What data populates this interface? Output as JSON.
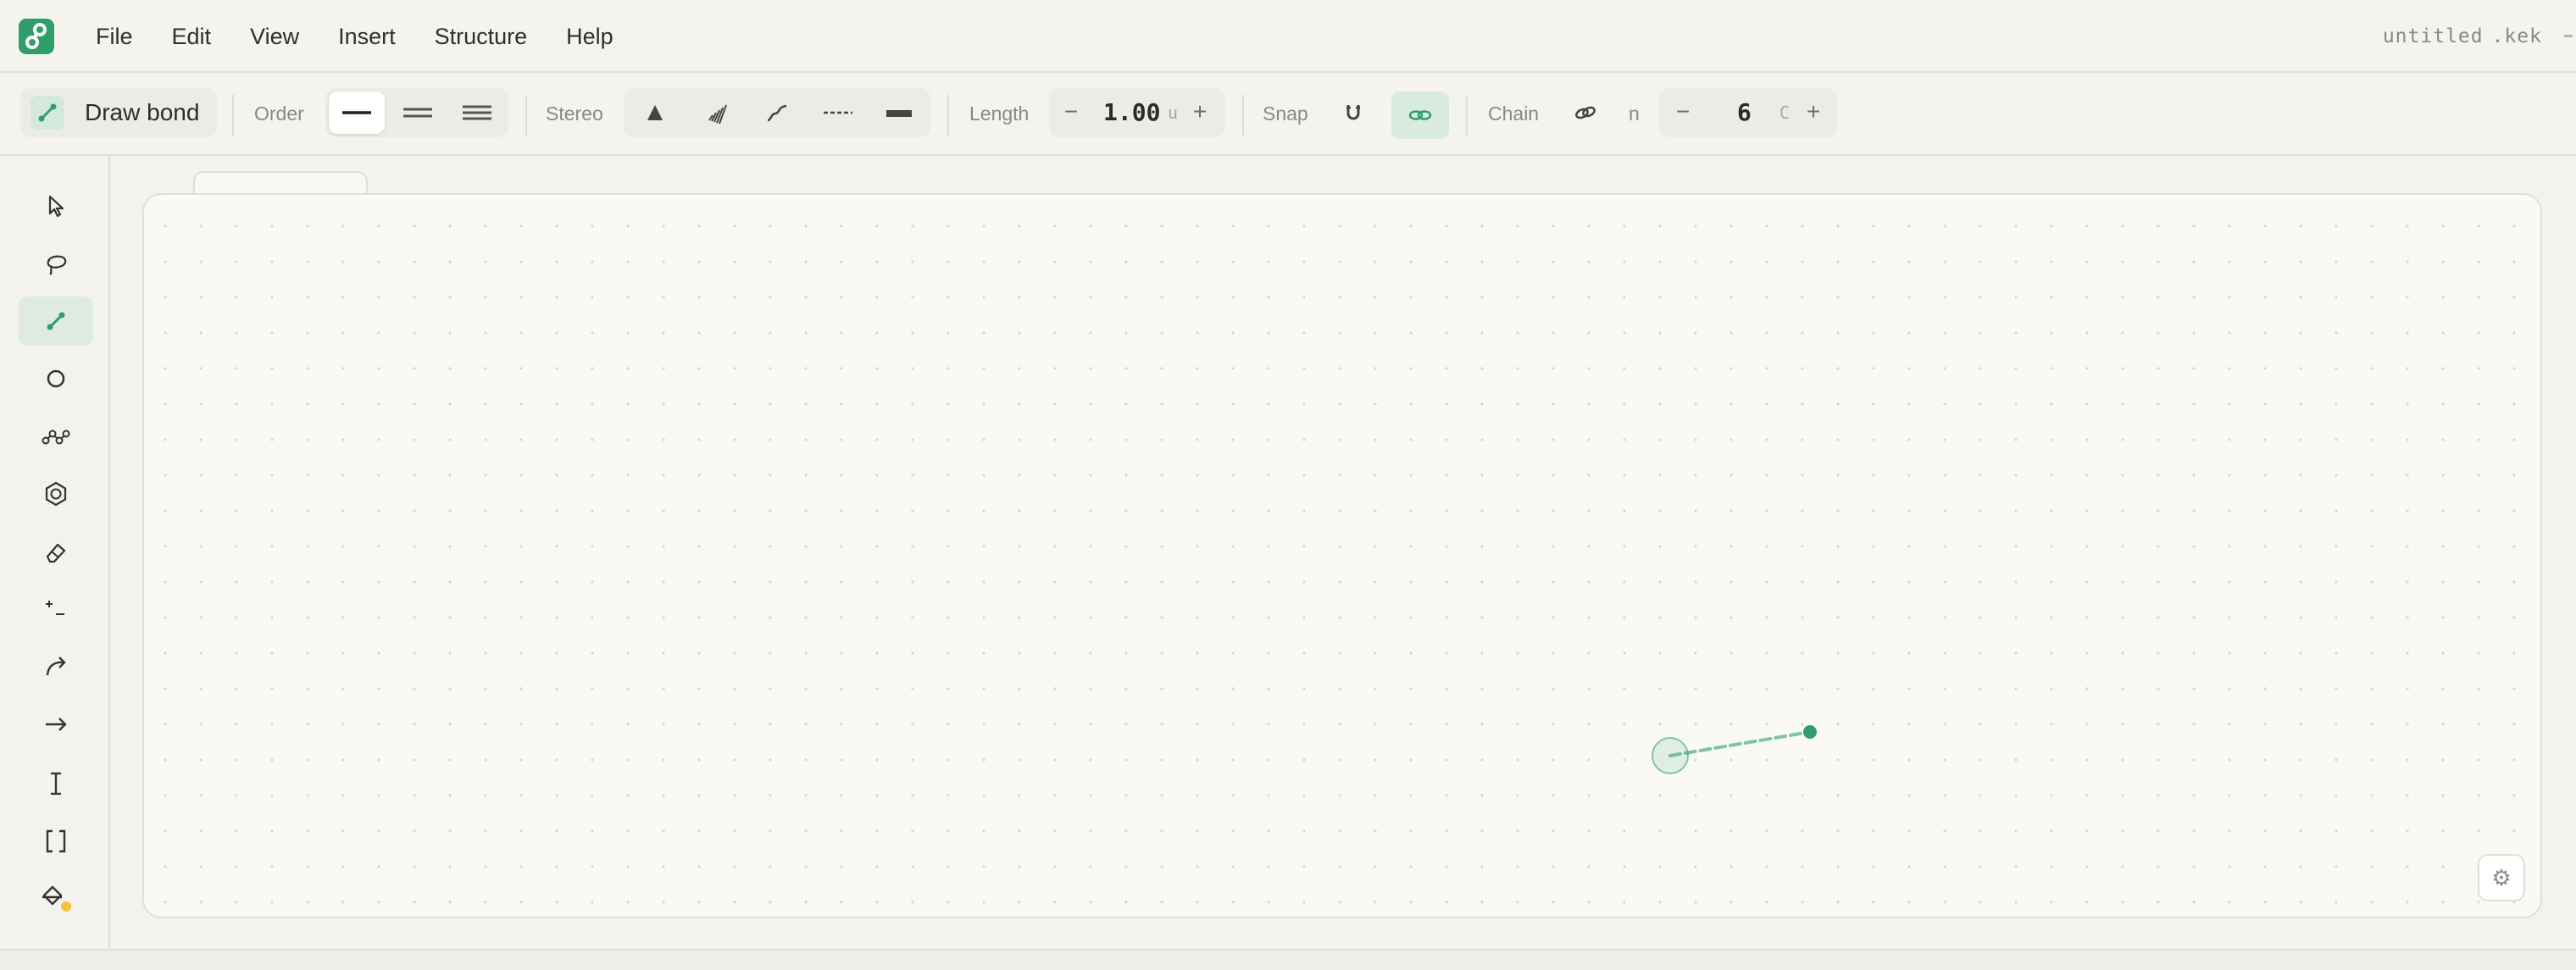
{
  "menubar": {
    "menus": [
      "File",
      "Edit",
      "View",
      "Insert",
      "Structure",
      "Help"
    ],
    "file_name": "untitled",
    "file_ext": ".kek"
  },
  "toolbar": {
    "active_tool_label": "Draw bond",
    "order_label": "Order",
    "order_options": [
      "single-bond",
      "double-bond",
      "triple-bond"
    ],
    "order_selected": "single-bond",
    "stereo_label": "Stereo",
    "stereo_options": [
      "wedge",
      "hashed-wedge",
      "wavy",
      "dashed",
      "bold"
    ],
    "length_label": "Length",
    "length_minus": "−",
    "length_value": "1.00",
    "length_unit": "u",
    "length_plus": "+",
    "snap_label": "Snap",
    "snap_magnet_active": false,
    "snap_link_active": true,
    "chain_label": "Chain",
    "n_label": "n",
    "chain_minus": "−",
    "chain_value": "6",
    "chain_unit": "C",
    "chain_plus": "+"
  },
  "rail": {
    "tools": [
      "select",
      "lasso",
      "bond",
      "atom",
      "chain",
      "ring",
      "eraser",
      "charge",
      "curved-arrow",
      "reaction-arrow",
      "text",
      "brackets",
      "fill"
    ],
    "active_tool": "bond",
    "fill_indicator_color": "#f3c33c"
  },
  "canvas": {
    "grid_color": "#d8d5cd",
    "bond_preview_color": "#2f9e6a",
    "settings_glyph": "⚙"
  },
  "colors": {
    "accent": "#2f9e6a",
    "accent_soft": "#d9ebdf",
    "background": "#f4f2ec",
    "canvas": "#faf9f5"
  }
}
